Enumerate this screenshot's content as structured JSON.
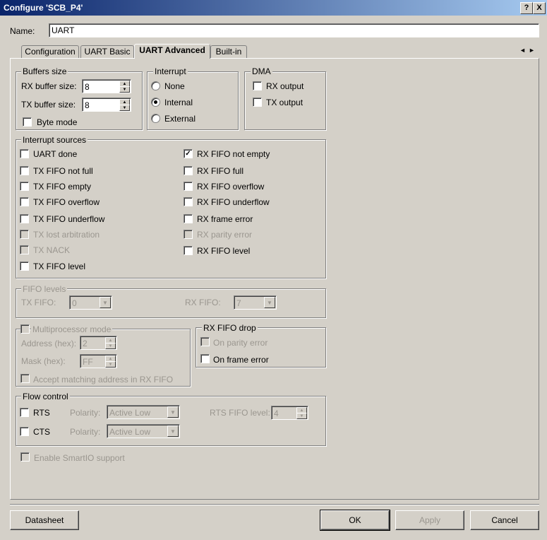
{
  "window": {
    "title": "Configure 'SCB_P4'",
    "help_btn": "?",
    "close_btn": "X"
  },
  "name_field": {
    "label": "Name:",
    "value": "UART"
  },
  "tabs": [
    {
      "label": "Configuration"
    },
    {
      "label": "UART Basic"
    },
    {
      "label": "UART Advanced"
    },
    {
      "label": "Built-in"
    }
  ],
  "tab_scroll": {
    "left": "◄",
    "right": "►"
  },
  "buffers": {
    "title": "Buffers size",
    "rx_label": "RX buffer size:",
    "rx_value": "8",
    "tx_label": "TX buffer size:",
    "tx_value": "8",
    "byte_mode": "Byte mode"
  },
  "interrupt": {
    "title": "Interrupt",
    "none": "None",
    "internal": "Internal",
    "external": "External",
    "selected": "Internal"
  },
  "dma": {
    "title": "DMA",
    "rx_output": "RX output",
    "tx_output": "TX output"
  },
  "interrupt_sources": {
    "title": "Interrupt sources",
    "left": [
      {
        "label": "UART done",
        "checked": false,
        "disabled": false
      },
      {
        "label": "TX FIFO not full",
        "checked": false,
        "disabled": false
      },
      {
        "label": "TX FIFO empty",
        "checked": false,
        "disabled": false
      },
      {
        "label": "TX FIFO overflow",
        "checked": false,
        "disabled": false
      },
      {
        "label": "TX FIFO underflow",
        "checked": false,
        "disabled": false
      },
      {
        "label": "TX lost arbitration",
        "checked": false,
        "disabled": true
      },
      {
        "label": "TX NACK",
        "checked": false,
        "disabled": true
      },
      {
        "label": "TX FIFO level",
        "checked": false,
        "disabled": false
      }
    ],
    "right": [
      {
        "label": "RX FIFO not empty",
        "checked": true,
        "disabled": false
      },
      {
        "label": "RX FIFO full",
        "checked": false,
        "disabled": false
      },
      {
        "label": "RX FIFO overflow",
        "checked": false,
        "disabled": false
      },
      {
        "label": "RX FIFO underflow",
        "checked": false,
        "disabled": false
      },
      {
        "label": "RX frame error",
        "checked": false,
        "disabled": false
      },
      {
        "label": "RX parity error",
        "checked": false,
        "disabled": true
      },
      {
        "label": "RX FIFO level",
        "checked": false,
        "disabled": false
      }
    ]
  },
  "fifo_levels": {
    "title": "FIFO levels",
    "tx_label": "TX FIFO:",
    "tx_value": "0",
    "rx_label": "RX FIFO:",
    "rx_value": "7"
  },
  "multiprocessor": {
    "title": "Multiprocessor mode",
    "address_label": "Address (hex):",
    "address_value": "2",
    "mask_label": "Mask (hex):",
    "mask_value": "FF",
    "accept": "Accept matching address in RX FIFO"
  },
  "rx_fifo_drop": {
    "title": "RX FIFO drop",
    "parity": "On parity error",
    "frame": "On frame error"
  },
  "flow_control": {
    "title": "Flow control",
    "rts": "RTS",
    "cts": "CTS",
    "polarity_label": "Polarity:",
    "rts_polarity": "Active Low",
    "cts_polarity": "Active Low",
    "rts_level_label": "RTS FIFO level:",
    "rts_level_value": "4"
  },
  "smartio": "Enable SmartIO support",
  "buttons": {
    "datasheet": "Datasheet",
    "ok": "OK",
    "apply": "Apply",
    "cancel": "Cancel"
  },
  "colors": {
    "titlebar_start": "#0a246a",
    "titlebar_end": "#a6caf0",
    "face": "#d4d0c8",
    "disabled_text": "#9a968f"
  }
}
